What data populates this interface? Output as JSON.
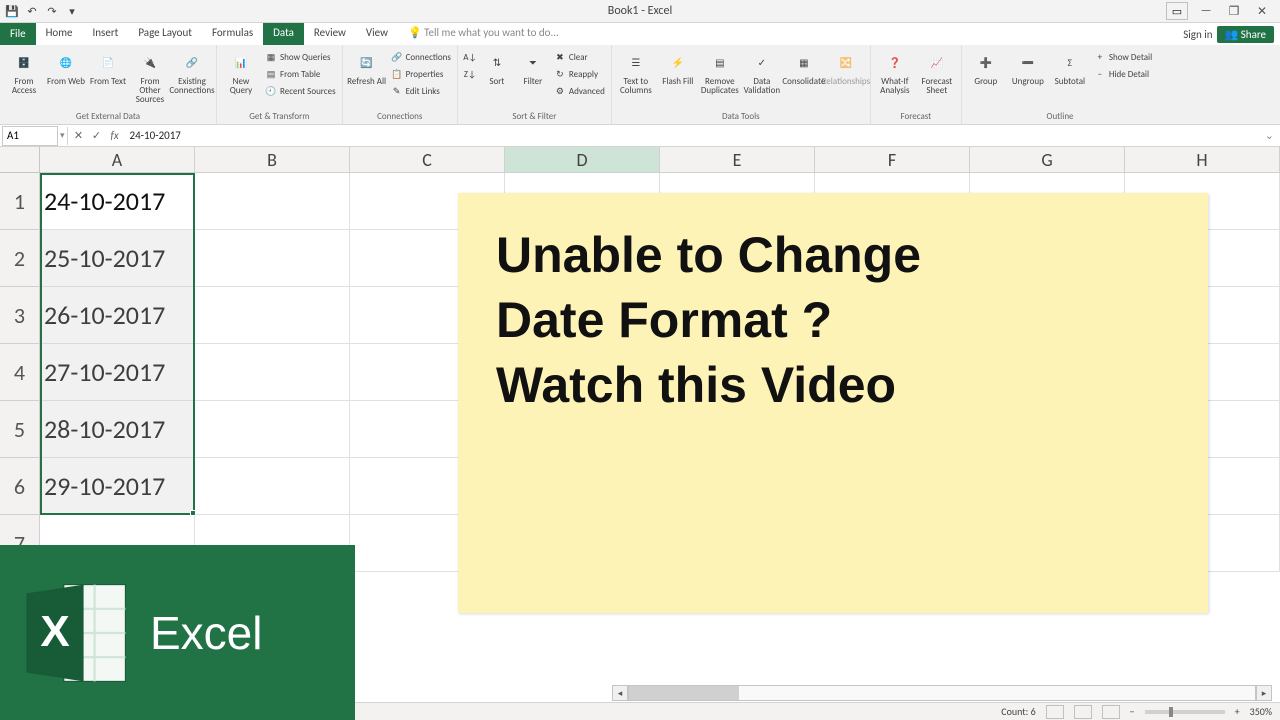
{
  "titlebar": {
    "title": "Book1 - Excel",
    "signin": "Sign in",
    "share": "Share"
  },
  "tabs": {
    "file": "File",
    "items": [
      "Home",
      "Insert",
      "Page Layout",
      "Formulas",
      "Data",
      "Review",
      "View"
    ],
    "active": "Data",
    "tellme": "Tell me what you want to do..."
  },
  "ribbon": {
    "g1": {
      "title": "Get External Data",
      "btns": {
        "access": "From Access",
        "web": "From Web",
        "text": "From Text",
        "other": "From Other Sources",
        "existing": "Existing Connections"
      }
    },
    "g2": {
      "title": "Get & Transform",
      "big": "New Query",
      "rows": [
        "Show Queries",
        "From Table",
        "Recent Sources"
      ]
    },
    "g3": {
      "title": "Connections",
      "big": "Refresh All",
      "rows": [
        "Connections",
        "Properties",
        "Edit Links"
      ]
    },
    "g4": {
      "title": "Sort & Filter",
      "az": "A→Z",
      "za": "Z→A",
      "sort": "Sort",
      "filter": "Filter",
      "rows": [
        "Clear",
        "Reapply",
        "Advanced"
      ]
    },
    "g5": {
      "title": "Data Tools",
      "btns": {
        "ttc": "Text to Columns",
        "flash": "Flash Fill",
        "dup": "Remove Duplicates",
        "val": "Data Validation",
        "cons": "Consolidate",
        "rel": "Relationships"
      }
    },
    "g6": {
      "title": "Forecast",
      "btns": {
        "whatif": "What-If Analysis",
        "sheet": "Forecast Sheet"
      }
    },
    "g7": {
      "title": "Outline",
      "btns": {
        "group": "Group",
        "ungroup": "Ungroup",
        "sub": "Subtotal"
      },
      "rows": [
        "Show Detail",
        "Hide Detail"
      ]
    }
  },
  "formula_bar": {
    "cell_ref": "A1",
    "value": "24-10-2017"
  },
  "columns": [
    "A",
    "B",
    "C",
    "D",
    "E",
    "F",
    "G",
    "H"
  ],
  "highlight_col": "D",
  "rows": [
    {
      "num": "1",
      "a": "24-10-2017"
    },
    {
      "num": "2",
      "a": "25-10-2017"
    },
    {
      "num": "3",
      "a": "26-10-2017"
    },
    {
      "num": "4",
      "a": "27-10-2017"
    },
    {
      "num": "5",
      "a": "28-10-2017"
    },
    {
      "num": "6",
      "a": "29-10-2017"
    },
    {
      "num": "7",
      "a": ""
    }
  ],
  "status": {
    "count_label": "Count:",
    "count_val": "6",
    "zoom": "350%"
  },
  "overlay": {
    "line1": "Unable to Change",
    "line2": "Date Format ?",
    "line3": "Watch this Video"
  },
  "badge": {
    "text": "Excel"
  }
}
